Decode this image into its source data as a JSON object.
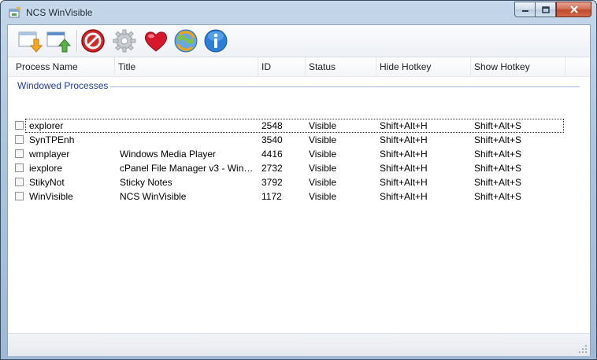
{
  "window": {
    "title": "NCS WinVisible"
  },
  "toolbar": {
    "buttons": [
      {
        "name": "hide-window-button",
        "icon": "window-arrow-down-icon"
      },
      {
        "name": "show-window-button",
        "icon": "window-arrow-up-icon"
      },
      {
        "name": "stop-button",
        "icon": "no-entry-icon"
      },
      {
        "name": "settings-button",
        "icon": "gear-icon"
      },
      {
        "name": "favorite-button",
        "icon": "heart-icon"
      },
      {
        "name": "update-button",
        "icon": "globe-refresh-icon"
      },
      {
        "name": "about-button",
        "icon": "info-icon"
      }
    ]
  },
  "table": {
    "columns": [
      "Process Name",
      "Title",
      "ID",
      "Status",
      "Hide Hotkey",
      "Show Hotkey"
    ],
    "group_label": "Windowed Processes",
    "rows": [
      {
        "process": "explorer",
        "title": "",
        "id": "2548",
        "status": "Visible",
        "hide": "Shift+Alt+H",
        "show": "Shift+Alt+S"
      },
      {
        "process": "SynTPEnh",
        "title": "",
        "id": "3540",
        "status": "Visible",
        "hide": "Shift+Alt+H",
        "show": "Shift+Alt+S"
      },
      {
        "process": "wmplayer",
        "title": "Windows Media Player",
        "id": "4416",
        "status": "Visible",
        "hide": "Shift+Alt+H",
        "show": "Shift+Alt+S"
      },
      {
        "process": "iexplore",
        "title": "cPanel File Manager v3 - Windo...",
        "id": "2732",
        "status": "Visible",
        "hide": "Shift+Alt+H",
        "show": "Shift+Alt+S"
      },
      {
        "process": "StikyNot",
        "title": "Sticky Notes",
        "id": "3792",
        "status": "Visible",
        "hide": "Shift+Alt+H",
        "show": "Shift+Alt+S"
      },
      {
        "process": "WinVisible",
        "title": "NCS WinVisible",
        "id": "1172",
        "status": "Visible",
        "hide": "Shift+Alt+H",
        "show": "Shift+Alt+S"
      }
    ]
  }
}
